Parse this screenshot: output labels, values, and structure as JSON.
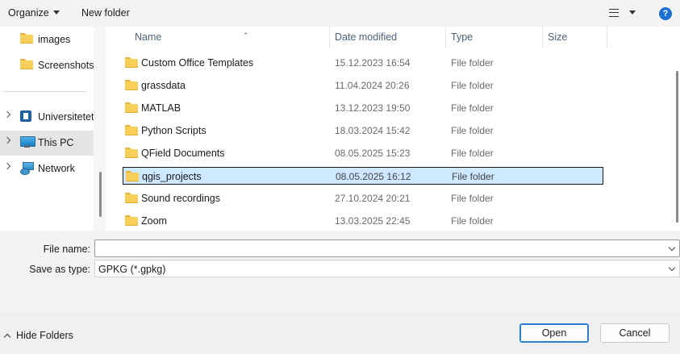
{
  "toolbar": {
    "organize_label": "Organize",
    "new_folder_label": "New folder",
    "view_icon": "list-view-icon",
    "help_label": "?"
  },
  "nav": {
    "items": [
      {
        "label": "images",
        "icon": "folder-icon"
      },
      {
        "label": "Screenshots",
        "icon": "folder-icon"
      },
      {
        "label": "Universitetet",
        "icon": "university-icon"
      },
      {
        "label": "This PC",
        "icon": "pc-icon"
      },
      {
        "label": "Network",
        "icon": "network-icon"
      }
    ]
  },
  "columns": {
    "name": "Name",
    "date": "Date modified",
    "type": "Type",
    "size": "Size"
  },
  "files": [
    {
      "name": "Custom Office Templates",
      "date": "15.12.2023 16:54",
      "type": "File folder"
    },
    {
      "name": "grassdata",
      "date": "11.04.2024 20:26",
      "type": "File folder"
    },
    {
      "name": "MATLAB",
      "date": "13.12.2023 19:50",
      "type": "File folder"
    },
    {
      "name": "Python Scripts",
      "date": "18.03.2024 15:42",
      "type": "File folder"
    },
    {
      "name": "QField Documents",
      "date": "08.05.2025 15:23",
      "type": "File folder"
    },
    {
      "name": "qgis_projects",
      "date": "08.05.2025 16:12",
      "type": "File folder",
      "selected": true
    },
    {
      "name": "Sound recordings",
      "date": "27.10.2024 20:21",
      "type": "File folder"
    },
    {
      "name": "Zoom",
      "date": "13.03.2025 22:45",
      "type": "File folder"
    }
  ],
  "form": {
    "file_name_label": "File name:",
    "file_name_value": "",
    "save_type_label": "Save as type:",
    "save_type_value": "GPKG (*.gpkg)"
  },
  "footer": {
    "hide_folders_label": "Hide Folders",
    "open_label": "Open",
    "cancel_label": "Cancel"
  }
}
